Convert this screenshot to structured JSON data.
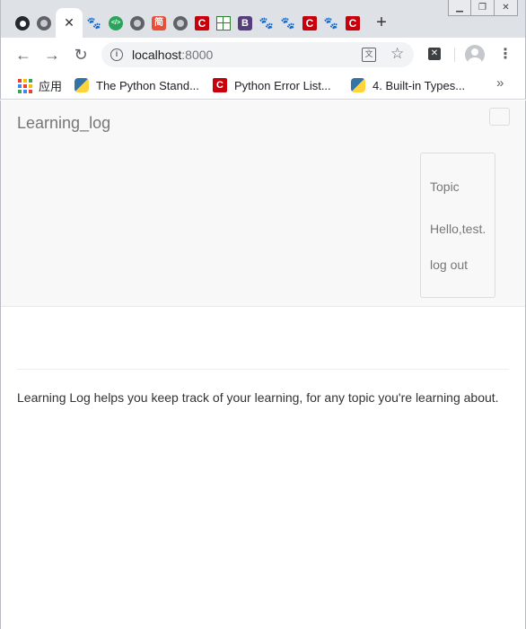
{
  "browser": {
    "tabs": [
      {
        "icon": "github-icon",
        "active": false
      },
      {
        "icon": "globe-icon",
        "active": false
      },
      {
        "icon": "close-icon",
        "active": true
      },
      {
        "icon": "baidu-paw-icon",
        "active": false
      },
      {
        "icon": "code-icon",
        "active": false
      },
      {
        "icon": "globe-icon",
        "active": false
      },
      {
        "icon": "jianshu-icon",
        "label": "简",
        "active": false
      },
      {
        "icon": "globe-icon",
        "active": false
      },
      {
        "icon": "csdn-icon",
        "label": "C",
        "active": false
      },
      {
        "icon": "grid-icon",
        "active": false
      },
      {
        "icon": "bootstrap-icon",
        "label": "B",
        "active": false
      },
      {
        "icon": "baidu-paw-icon",
        "active": false
      },
      {
        "icon": "baidu-paw-icon",
        "active": false
      },
      {
        "icon": "csdn-icon",
        "label": "C",
        "active": false
      },
      {
        "icon": "baidu-paw-icon",
        "active": false
      },
      {
        "icon": "csdn-icon",
        "label": "C",
        "active": false
      }
    ],
    "address": {
      "host": "localhost",
      "port": ":8000"
    },
    "bookmarks": [
      {
        "icon": "apps-grid-icon",
        "label": "应用"
      },
      {
        "icon": "python-icon",
        "label": "The Python Stand..."
      },
      {
        "icon": "csdn-icon",
        "label": "Python Error List..."
      },
      {
        "icon": "python-icon",
        "label": "4. Built-in Types..."
      }
    ],
    "colors": {
      "tabstrip": "#dee1e6",
      "csdn": "#c7000b",
      "bootstrap": "#563d7c"
    }
  },
  "page": {
    "brand": "Learning_log",
    "nav": {
      "topic": "Topic",
      "greeting": "Hello,test.",
      "logout": "log out"
    },
    "lead": "Learning Log helps you keep track of your learning, for any topic you're learning about."
  }
}
